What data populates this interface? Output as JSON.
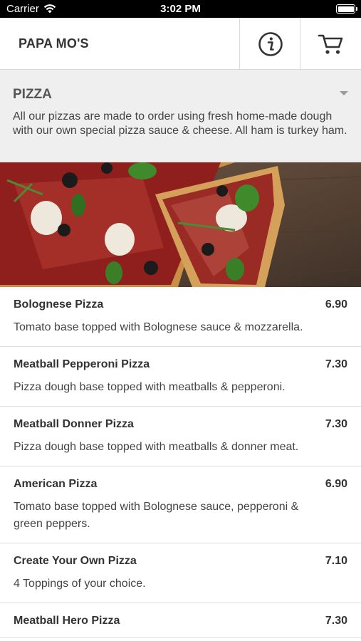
{
  "status_bar": {
    "carrier": "Carrier",
    "time": "3:02 PM"
  },
  "header": {
    "brand": "PAPA MO'S",
    "info_icon": "info-circle-icon",
    "cart_icon": "cart-icon"
  },
  "category": {
    "title": "PIZZA",
    "description": "All our pizzas are made to order using fresh home-made dough with our own special pizza sauce & cheese. All ham is turkey ham."
  },
  "items": [
    {
      "name": "Bolognese Pizza",
      "price": "6.90",
      "description": "Tomato base topped with Bolognese sauce & mozzarella."
    },
    {
      "name": "Meatball Pepperoni Pizza",
      "price": "7.30",
      "description": "Pizza dough base topped with meatballs & pepperoni."
    },
    {
      "name": "Meatball Donner Pizza",
      "price": "7.30",
      "description": "Pizza dough base topped with meatballs & donner meat."
    },
    {
      "name": "American Pizza",
      "price": "6.90",
      "description": "Tomato base topped with Bolognese sauce, pepperoni & green peppers."
    },
    {
      "name": "Create Your Own Pizza",
      "price": "7.10",
      "description": "4 Toppings of your choice."
    },
    {
      "name": "Meatball Hero Pizza",
      "price": "7.30",
      "description": ""
    }
  ]
}
